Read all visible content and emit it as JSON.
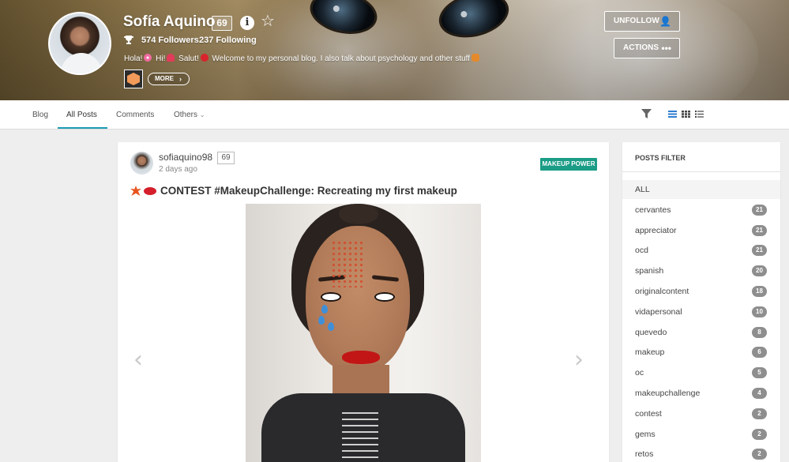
{
  "profile": {
    "name": "Sofía Aquino",
    "reputation": "69",
    "followers": "574 Followers",
    "following": "237 Following",
    "bio": {
      "part1": "Hola!",
      "part2": "Hi!",
      "part3": "Salut!",
      "part4": "Welcome to my personal blog. I also talk about psychology and other stuff"
    },
    "more_label": "MORE",
    "unfollow_label": "UNFOLLOW",
    "actions_label": "ACTIONS"
  },
  "tabs": [
    {
      "label": "Blog"
    },
    {
      "label": "All Posts",
      "active": true
    },
    {
      "label": "Comments"
    },
    {
      "label": "Others"
    }
  ],
  "post": {
    "author": "sofiaquino98",
    "reputation": "69",
    "time": "2 days ago",
    "tag": "MAKEUP POWER",
    "title": "CONTEST #MakeupChallenge: Recreating my first makeup"
  },
  "filter": {
    "heading": "POSTS FILTER",
    "all_label": "ALL",
    "items": [
      {
        "label": "cervantes",
        "count": "21"
      },
      {
        "label": "appreciator",
        "count": "21"
      },
      {
        "label": "ocd",
        "count": "21"
      },
      {
        "label": "spanish",
        "count": "20"
      },
      {
        "label": "originalcontent",
        "count": "18"
      },
      {
        "label": "vidapersonal",
        "count": "10"
      },
      {
        "label": "quevedo",
        "count": "8"
      },
      {
        "label": "makeup",
        "count": "6"
      },
      {
        "label": "oc",
        "count": "5"
      },
      {
        "label": "makeupchallenge",
        "count": "4"
      },
      {
        "label": "contest",
        "count": "2"
      },
      {
        "label": "gems",
        "count": "2"
      },
      {
        "label": "retos",
        "count": "2"
      }
    ]
  },
  "colors": {
    "accent": "#1e9bb5",
    "tag": "#1b9c86",
    "view_active": "#2f7ed0"
  }
}
